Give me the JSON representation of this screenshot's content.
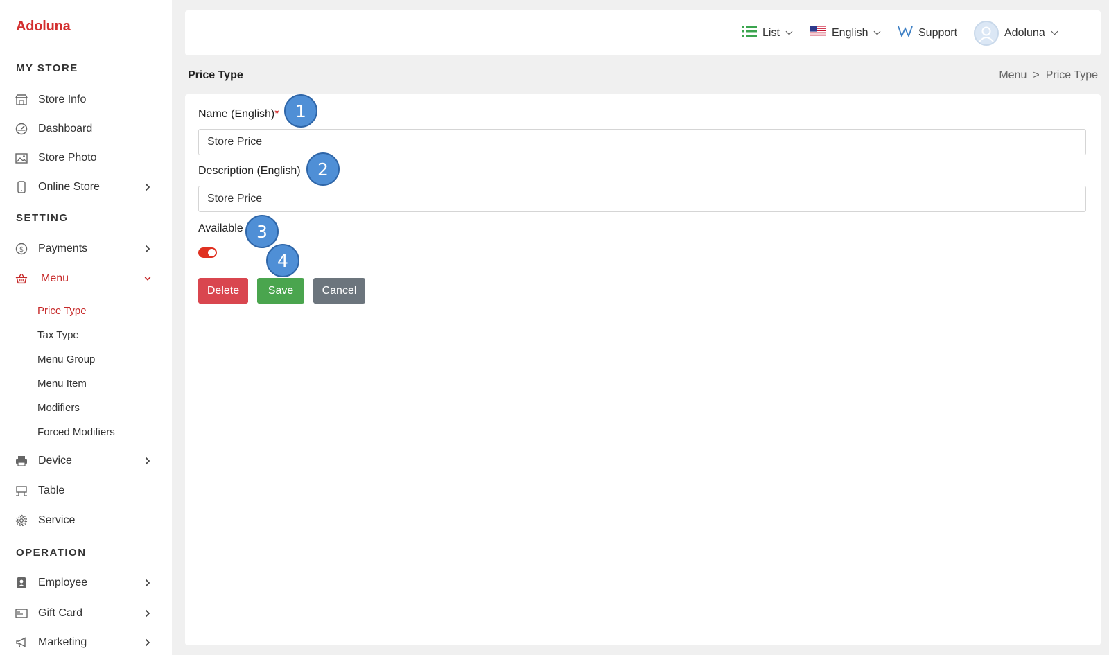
{
  "brand": {
    "name": "Adoluna",
    "color": "#d32f2f"
  },
  "sidebar": {
    "sections": [
      {
        "title": "MY STORE"
      },
      {
        "title": "SETTING"
      },
      {
        "title": "OPERATION"
      }
    ],
    "items": [
      {
        "label": "Store Info",
        "icon": "store-icon"
      },
      {
        "label": "Dashboard",
        "icon": "dashboard-gauge-icon"
      },
      {
        "label": "Store Photo",
        "icon": "photo-icon"
      },
      {
        "label": "Online Store",
        "icon": "mobile-icon",
        "has_submenu": true
      },
      {
        "label": "Payments",
        "icon": "dollar-coin-icon",
        "has_submenu": true
      },
      {
        "label": "Menu",
        "icon": "basket-icon",
        "expanded": true,
        "active": true
      },
      {
        "label": "Device",
        "icon": "printer-icon",
        "has_submenu": true
      },
      {
        "label": "Table",
        "icon": "table-icon"
      },
      {
        "label": "Service",
        "icon": "gear-icon"
      },
      {
        "label": "Employee",
        "icon": "id-badge-icon",
        "has_submenu": true
      },
      {
        "label": "Gift Card",
        "icon": "gift-card-icon",
        "has_submenu": true
      },
      {
        "label": "Marketing",
        "icon": "megaphone-icon",
        "has_submenu": true
      }
    ],
    "menu_subitems": [
      {
        "label": "Price Type",
        "active": true
      },
      {
        "label": "Tax Type"
      },
      {
        "label": "Menu Group"
      },
      {
        "label": "Menu Item"
      },
      {
        "label": "Modifiers"
      },
      {
        "label": "Forced Modifiers"
      }
    ]
  },
  "topbar": {
    "list_label": "List",
    "language_label": "English",
    "support_label": "Support",
    "user_label": "Adoluna"
  },
  "page": {
    "title": "Price Type",
    "breadcrumb": [
      "Menu",
      ">",
      "Price Type"
    ]
  },
  "form": {
    "name_label": "Name (English)",
    "name_required_mark": "*",
    "name_value": "Store Price",
    "description_label": "Description (English)",
    "description_value": "Store Price",
    "available_label": "Available",
    "available_on": true,
    "delete_label": "Delete",
    "save_label": "Save",
    "cancel_label": "Cancel"
  },
  "markers": [
    "1",
    "2",
    "3",
    "4"
  ],
  "colors": {
    "accent_red": "#c62828",
    "delete": "#d9464f",
    "save": "#4aa54e",
    "cancel": "#6c757d",
    "toggle_on": "#e03121",
    "marker": "#4f8fd6"
  }
}
